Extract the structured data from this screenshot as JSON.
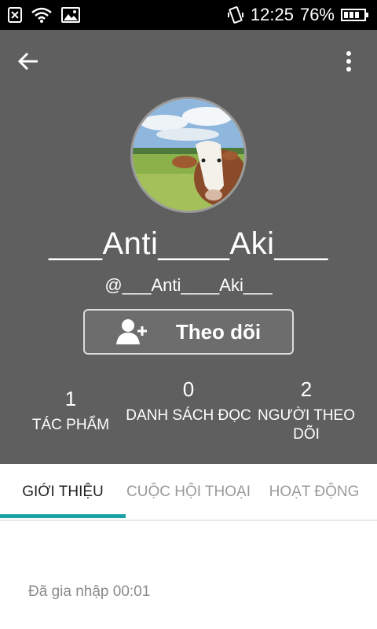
{
  "statusbar": {
    "time": "12:25",
    "battery": "76%",
    "icons": [
      "notification-x-icon",
      "wifi-icon",
      "image-icon",
      "vibrate-icon",
      "battery-icon"
    ]
  },
  "toolbar": {
    "back_icon": "back-arrow-icon",
    "more_icon": "more-vert-icon"
  },
  "profile": {
    "display_name": "___Anti____Aki___",
    "username": "@___Anti____Aki___",
    "avatar_icon": "avatar-cow-photo",
    "follow_label": "Theo dõi"
  },
  "stats": [
    {
      "value": "1",
      "label": "TÁC PHẨM"
    },
    {
      "value": "0",
      "label": "DANH SÁCH ĐỌC"
    },
    {
      "value": "2",
      "label": "NGƯỜI THEO DÕI"
    }
  ],
  "tabs": [
    {
      "label": "GIỚI THIỆU",
      "active": true
    },
    {
      "label": "CUỘC HỘI THOẠI",
      "active": false
    },
    {
      "label": "HOẠT ĐỘNG",
      "active": false
    }
  ],
  "about": {
    "joined_text": "Đã gia nhập 00:01"
  },
  "colors": {
    "header_bg": "#5f5f5f",
    "accent": "#19a2a6"
  }
}
